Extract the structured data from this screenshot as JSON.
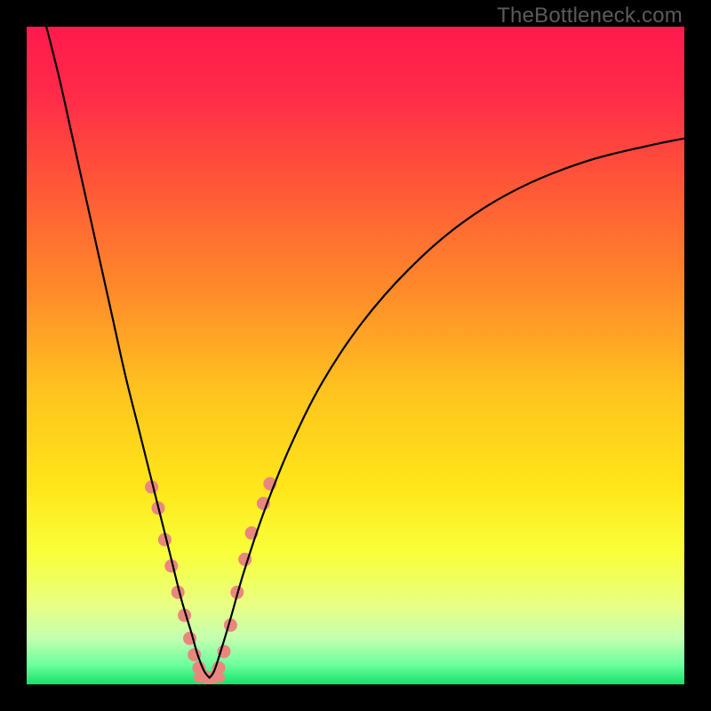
{
  "watermark": "TheBottleneck.com",
  "colors": {
    "frame": "#000000",
    "gradient_stops": [
      {
        "offset": 0.0,
        "color": "#ff1a4d"
      },
      {
        "offset": 0.1,
        "color": "#ff2a49"
      },
      {
        "offset": 0.25,
        "color": "#ff5a37"
      },
      {
        "offset": 0.4,
        "color": "#ff8a2a"
      },
      {
        "offset": 0.55,
        "color": "#ffc21f"
      },
      {
        "offset": 0.7,
        "color": "#ffe61a"
      },
      {
        "offset": 0.8,
        "color": "#f9ff3a"
      },
      {
        "offset": 0.88,
        "color": "#e8ff84"
      },
      {
        "offset": 0.93,
        "color": "#c4ffb0"
      },
      {
        "offset": 0.97,
        "color": "#6dff9e"
      },
      {
        "offset": 1.0,
        "color": "#18e06a"
      }
    ],
    "curve": "#000000",
    "dot_fill": "#e9877f",
    "dot_stroke": "#c9675f"
  },
  "chart_data": {
    "type": "line",
    "title": "",
    "xlabel": "",
    "ylabel": "",
    "xlim": [
      0,
      100
    ],
    "ylim": [
      0,
      100
    ],
    "series": [
      {
        "name": "left_curve",
        "x": [
          3,
          5,
          7,
          9,
          11,
          13,
          15,
          17,
          19,
          20.5,
          22,
          23.5,
          25,
          26,
          27,
          27.8
        ],
        "y": [
          100,
          92,
          83,
          74,
          65,
          56,
          47,
          39,
          31,
          25,
          19,
          13,
          8,
          4.5,
          2,
          1
        ]
      },
      {
        "name": "right_curve",
        "x": [
          27.8,
          28.5,
          29.5,
          31,
          33,
          36,
          40,
          45,
          51,
          58,
          66,
          75,
          85,
          95,
          100
        ],
        "y": [
          1,
          2,
          5,
          10,
          17,
          26,
          36,
          46,
          55,
          63,
          70,
          75.5,
          79.5,
          82,
          83
        ]
      },
      {
        "name": "flat_bottom",
        "x": [
          26.0,
          29.5
        ],
        "y": [
          1,
          1
        ]
      }
    ],
    "dots": [
      {
        "x": 19.0,
        "y": 30.0
      },
      {
        "x": 20.0,
        "y": 26.8
      },
      {
        "x": 21.0,
        "y": 22.0
      },
      {
        "x": 22.0,
        "y": 18.0
      },
      {
        "x": 23.0,
        "y": 14.0
      },
      {
        "x": 24.0,
        "y": 10.5
      },
      {
        "x": 24.8,
        "y": 7.0
      },
      {
        "x": 25.5,
        "y": 4.5
      },
      {
        "x": 26.2,
        "y": 2.5
      },
      {
        "x": 27.0,
        "y": 1.2
      },
      {
        "x": 27.8,
        "y": 1.0
      },
      {
        "x": 28.6,
        "y": 1.2
      },
      {
        "x": 29.2,
        "y": 2.5
      },
      {
        "x": 30.0,
        "y": 5.0
      },
      {
        "x": 31.0,
        "y": 9.0
      },
      {
        "x": 32.0,
        "y": 14.0
      },
      {
        "x": 33.2,
        "y": 19.0
      },
      {
        "x": 34.2,
        "y": 23.0
      },
      {
        "x": 36.0,
        "y": 27.5
      },
      {
        "x": 37.0,
        "y": 30.5
      }
    ]
  }
}
